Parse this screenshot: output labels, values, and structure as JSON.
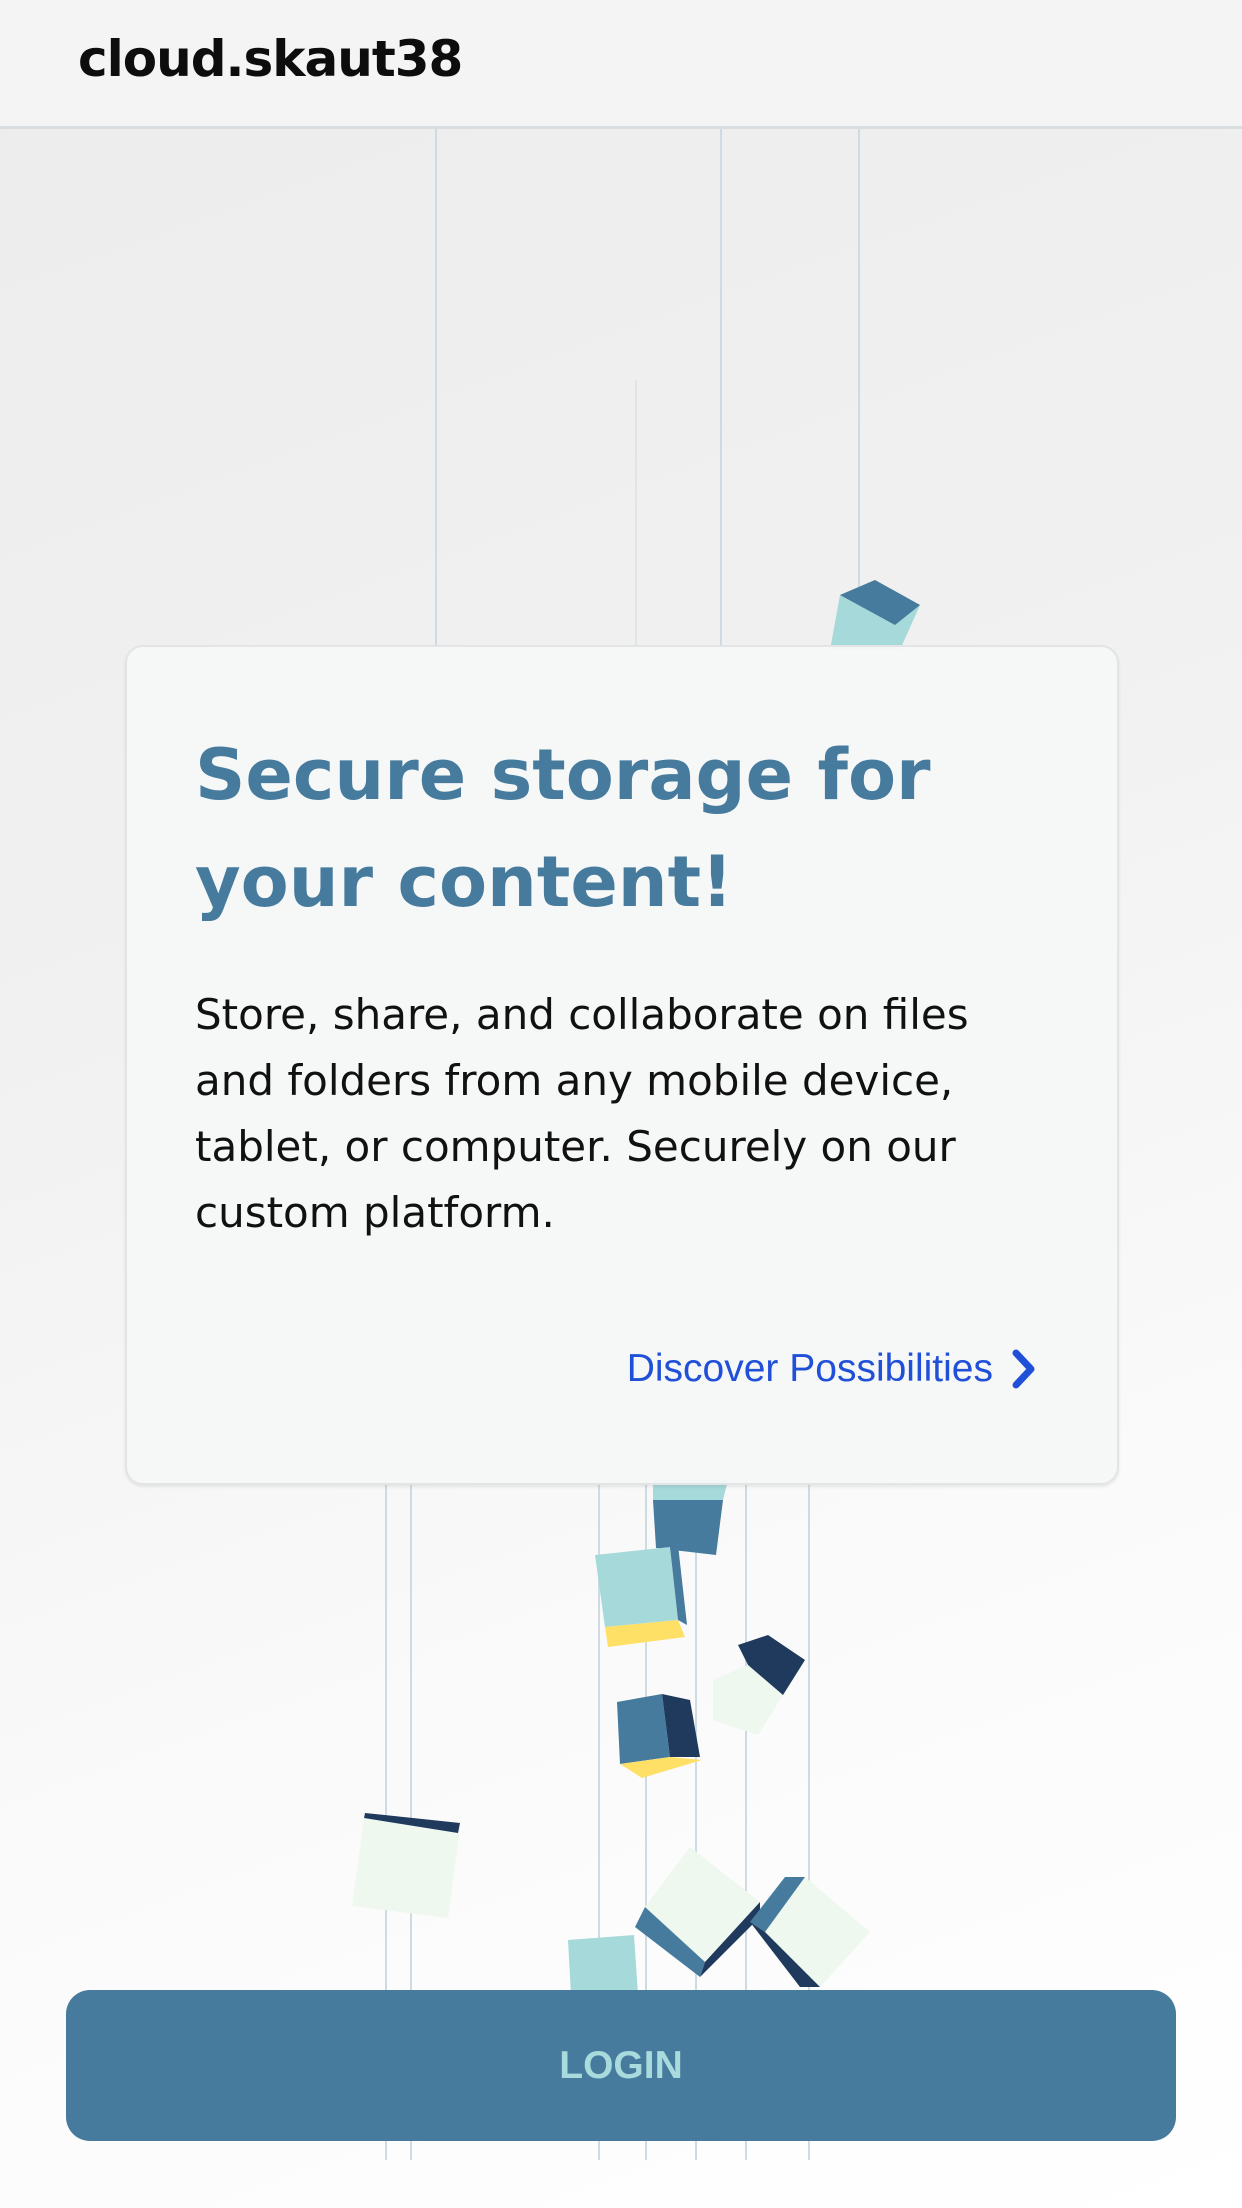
{
  "header": {
    "logo": "cloud.skaut38"
  },
  "hero": {
    "title": "Secure storage for your content!",
    "description": "Store, share, and collaborate on files and folders from any mobile device, tablet, or computer. Securely on our custom platform.",
    "link_label": "Discover Possibilities",
    "link_icon": "chevron-right-icon"
  },
  "login": {
    "label": "LOGIN"
  },
  "colors": {
    "accent": "#467b9e",
    "link": "#2150d8",
    "button_text": "#a9dadc",
    "cube_teal": "#a6d9da",
    "cube_navy": "#1f3a5c",
    "cube_yellow": "#ffe066",
    "cube_mint": "#eef8ee"
  }
}
